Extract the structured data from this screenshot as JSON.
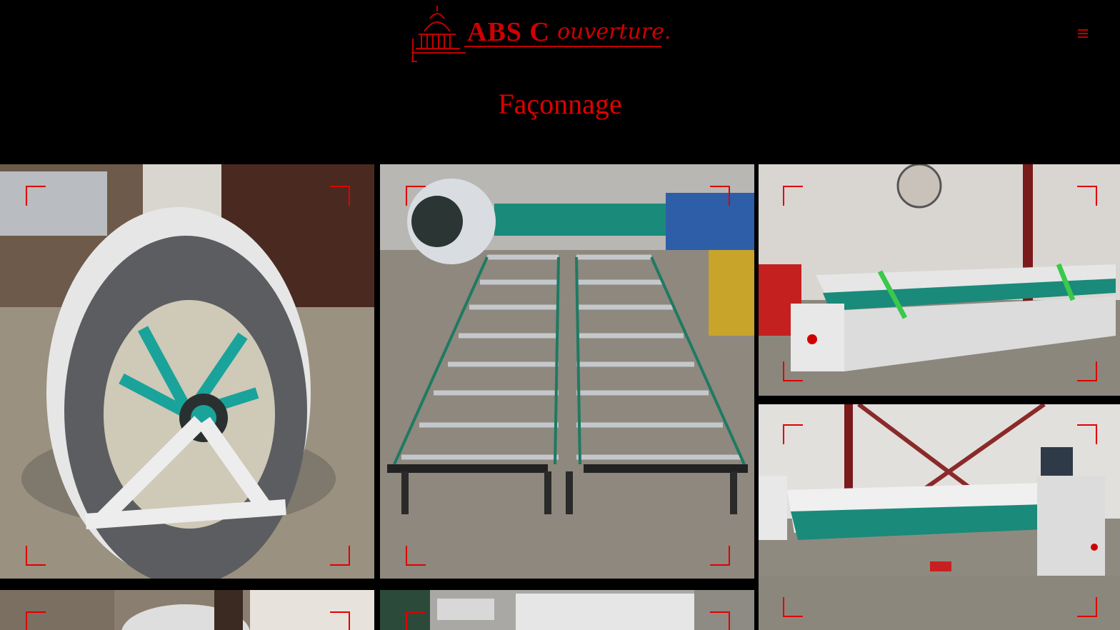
{
  "site": {
    "logo_main": "ABS C",
    "logo_script": "ouverture.",
    "logo_icon": "capitol-dome-icon",
    "menu_icon": "hamburger-menu-icon"
  },
  "page": {
    "title": "Façonnage"
  },
  "colors": {
    "background": "#000000",
    "accent": "#e00000",
    "machine_green": "#1a9a8a"
  },
  "gallery": {
    "items": [
      {
        "subject": "coil-decoiler"
      },
      {
        "subject": "roller-conveyor-table"
      },
      {
        "subject": "folding-machine-green-straps"
      },
      {
        "subject": "folding-machine-control-panel"
      },
      {
        "subject": "coil-partial"
      },
      {
        "subject": "workshop-partial"
      }
    ]
  }
}
